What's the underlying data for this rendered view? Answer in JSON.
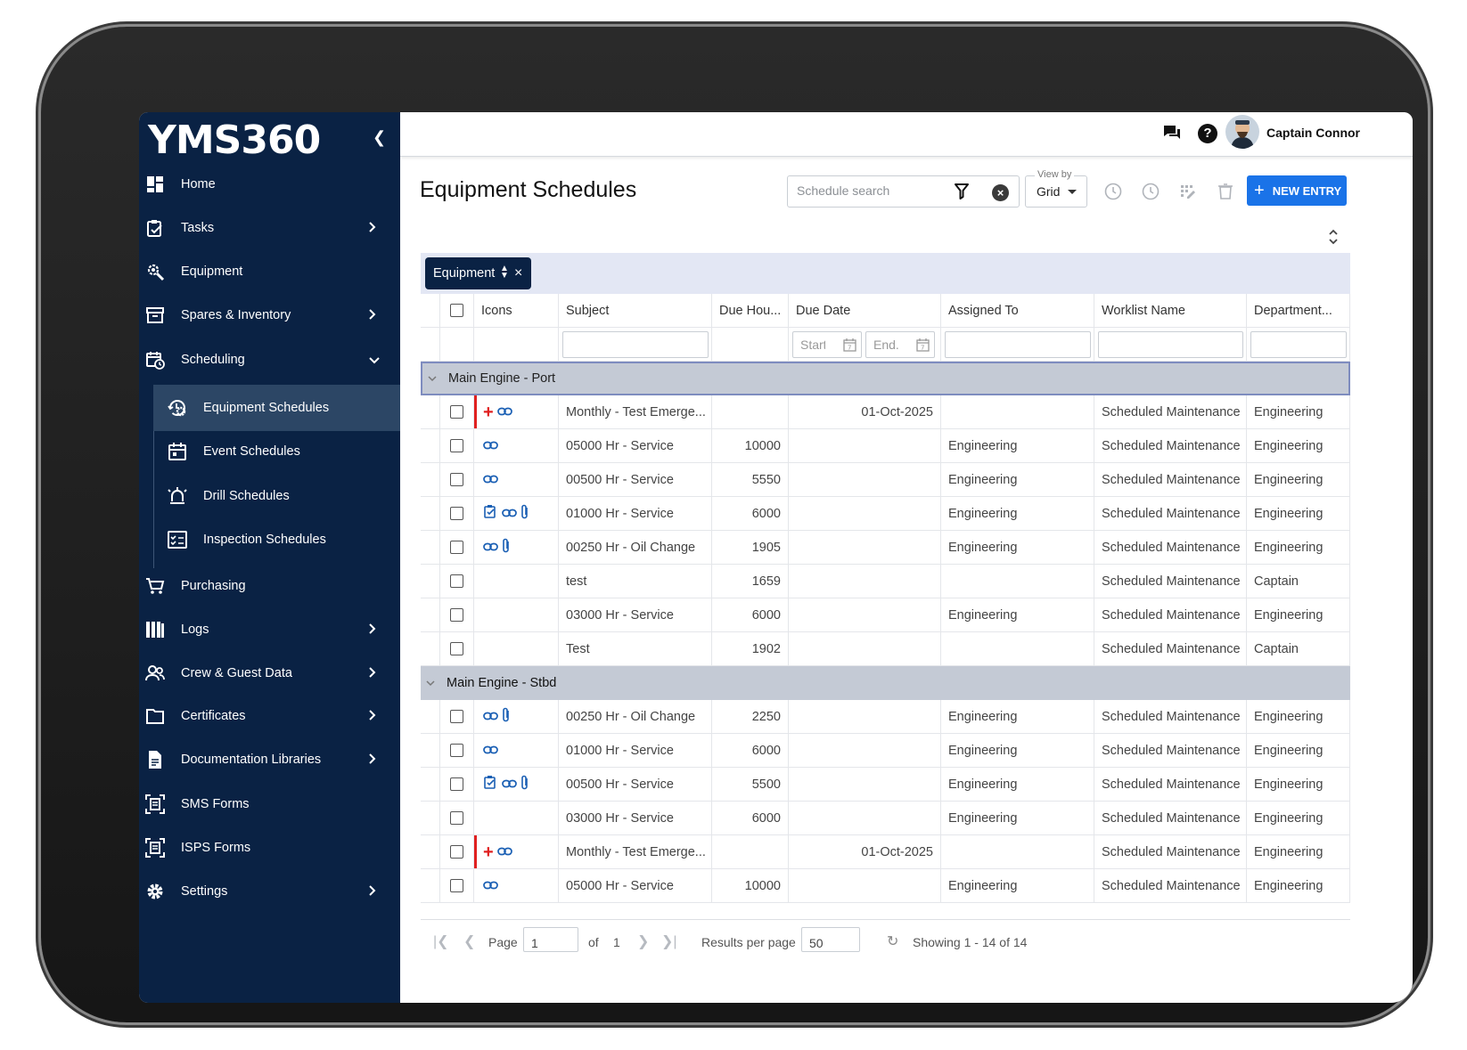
{
  "app": {
    "logo": "YMS360"
  },
  "sidebar": {
    "items": [
      {
        "label": "Home",
        "icon": "dashboard-icon",
        "has_chevron": false
      },
      {
        "label": "Tasks",
        "icon": "clipboard-check-icon",
        "has_chevron": true
      },
      {
        "label": "Equipment",
        "icon": "wrench-gear-icon",
        "has_chevron": false
      },
      {
        "label": "Spares & Inventory",
        "icon": "inventory-box-icon",
        "has_chevron": true
      },
      {
        "label": "Scheduling",
        "icon": "calendar-clock-icon",
        "has_chevron": true,
        "expanded": true
      },
      {
        "label": "Purchasing",
        "icon": "cart-icon",
        "has_chevron": false
      },
      {
        "label": "Logs",
        "icon": "books-icon",
        "has_chevron": true
      },
      {
        "label": "Crew & Guest Data",
        "icon": "people-icon",
        "has_chevron": true
      },
      {
        "label": "Certificates",
        "icon": "folder-icon",
        "has_chevron": true
      },
      {
        "label": "Documentation Libraries",
        "icon": "document-icon",
        "has_chevron": true
      },
      {
        "label": "SMS Forms",
        "icon": "form-scan-icon",
        "has_chevron": false
      },
      {
        "label": "ISPS Forms",
        "icon": "form-scan-icon",
        "has_chevron": false
      },
      {
        "label": "Settings",
        "icon": "gear-icon",
        "has_chevron": true
      }
    ],
    "scheduling_sub": [
      {
        "label": "Equipment Schedules",
        "icon": "gear-clock-icon",
        "active": true
      },
      {
        "label": "Event Schedules",
        "icon": "calendar-icon",
        "active": false
      },
      {
        "label": "Drill Schedules",
        "icon": "alarm-icon",
        "active": false
      },
      {
        "label": "Inspection Schedules",
        "icon": "checklist-icon",
        "active": false
      }
    ]
  },
  "topbar": {
    "user_name": "Captain Connor"
  },
  "header": {
    "title": "Equipment Schedules",
    "search_placeholder": "Schedule search",
    "view_by_label": "View by",
    "view_by_value": "Grid",
    "new_entry_label": "NEW ENTRY"
  },
  "grid": {
    "group_chip": "Equipment",
    "columns": [
      "Icons",
      "Subject",
      "Due Hou...",
      "Due Date",
      "Assigned To",
      "Worklist Name",
      "Department..."
    ],
    "date_filter_start_placeholder": "Start",
    "date_filter_end_placeholder": "End.",
    "groups": [
      {
        "name": "Main Engine - Port",
        "rows": [
          {
            "icons": [
              "plus",
              "link"
            ],
            "flag": true,
            "subject": "Monthly - Test Emerge...",
            "due_hours": "",
            "due_date": "01-Oct-2025",
            "assigned_to": "",
            "worklist": "Scheduled Maintenance",
            "department": "Engineering"
          },
          {
            "icons": [
              "link"
            ],
            "flag": false,
            "subject": "05000 Hr - Service",
            "due_hours": "10000",
            "due_date": "",
            "assigned_to": "Engineering",
            "worklist": "Scheduled Maintenance",
            "department": "Engineering"
          },
          {
            "icons": [
              "link"
            ],
            "flag": false,
            "subject": "00500 Hr - Service",
            "due_hours": "5550",
            "due_date": "",
            "assigned_to": "Engineering",
            "worklist": "Scheduled Maintenance",
            "department": "Engineering"
          },
          {
            "icons": [
              "task",
              "link",
              "clip"
            ],
            "flag": false,
            "subject": "01000 Hr - Service",
            "due_hours": "6000",
            "due_date": "",
            "assigned_to": "Engineering",
            "worklist": "Scheduled Maintenance",
            "department": "Engineering"
          },
          {
            "icons": [
              "link",
              "clip"
            ],
            "flag": false,
            "subject": "00250 Hr - Oil Change",
            "due_hours": "1905",
            "due_date": "",
            "assigned_to": "Engineering",
            "worklist": "Scheduled Maintenance",
            "department": "Engineering"
          },
          {
            "icons": [],
            "flag": false,
            "subject": "test",
            "due_hours": "1659",
            "due_date": "",
            "assigned_to": "",
            "worklist": "Scheduled Maintenance",
            "department": "Captain"
          },
          {
            "icons": [],
            "flag": false,
            "subject": "03000 Hr - Service",
            "due_hours": "6000",
            "due_date": "",
            "assigned_to": "Engineering",
            "worklist": "Scheduled Maintenance",
            "department": "Engineering"
          },
          {
            "icons": [],
            "flag": false,
            "subject": "Test",
            "due_hours": "1902",
            "due_date": "",
            "assigned_to": "",
            "worklist": "Scheduled Maintenance",
            "department": "Captain"
          }
        ]
      },
      {
        "name": "Main Engine - Stbd",
        "rows": [
          {
            "icons": [
              "link",
              "clip"
            ],
            "flag": false,
            "subject": "00250 Hr - Oil Change",
            "due_hours": "2250",
            "due_date": "",
            "assigned_to": "Engineering",
            "worklist": "Scheduled Maintenance",
            "department": "Engineering"
          },
          {
            "icons": [
              "link"
            ],
            "flag": false,
            "subject": "01000 Hr - Service",
            "due_hours": "6000",
            "due_date": "",
            "assigned_to": "Engineering",
            "worklist": "Scheduled Maintenance",
            "department": "Engineering"
          },
          {
            "icons": [
              "task",
              "link",
              "clip"
            ],
            "flag": false,
            "subject": "00500 Hr - Service",
            "due_hours": "5500",
            "due_date": "",
            "assigned_to": "Engineering",
            "worklist": "Scheduled Maintenance",
            "department": "Engineering"
          },
          {
            "icons": [],
            "flag": false,
            "subject": "03000 Hr - Service",
            "due_hours": "6000",
            "due_date": "",
            "assigned_to": "Engineering",
            "worklist": "Scheduled Maintenance",
            "department": "Engineering"
          },
          {
            "icons": [
              "plus",
              "link"
            ],
            "flag": true,
            "subject": "Monthly - Test Emerge...",
            "due_hours": "",
            "due_date": "01-Oct-2025",
            "assigned_to": "",
            "worklist": "Scheduled Maintenance",
            "department": "Engineering"
          },
          {
            "icons": [
              "link"
            ],
            "flag": false,
            "subject": "05000 Hr - Service",
            "due_hours": "10000",
            "due_date": "",
            "assigned_to": "Engineering",
            "worklist": "Scheduled Maintenance",
            "department": "Engineering"
          }
        ]
      }
    ]
  },
  "pager": {
    "page_label": "Page",
    "page_value": "1",
    "of_label": "of",
    "total_pages": "1",
    "results_label": "Results per page",
    "results_value": "50",
    "showing": "Showing 1 - 14 of 14"
  },
  "colors": {
    "sidebar_bg": "#0a2244",
    "sidebar_active": "#2c4665",
    "accent": "#1a73e8",
    "group_row": "#c4cad5",
    "flag": "#e02020",
    "link_icon": "#1a5fb4"
  }
}
